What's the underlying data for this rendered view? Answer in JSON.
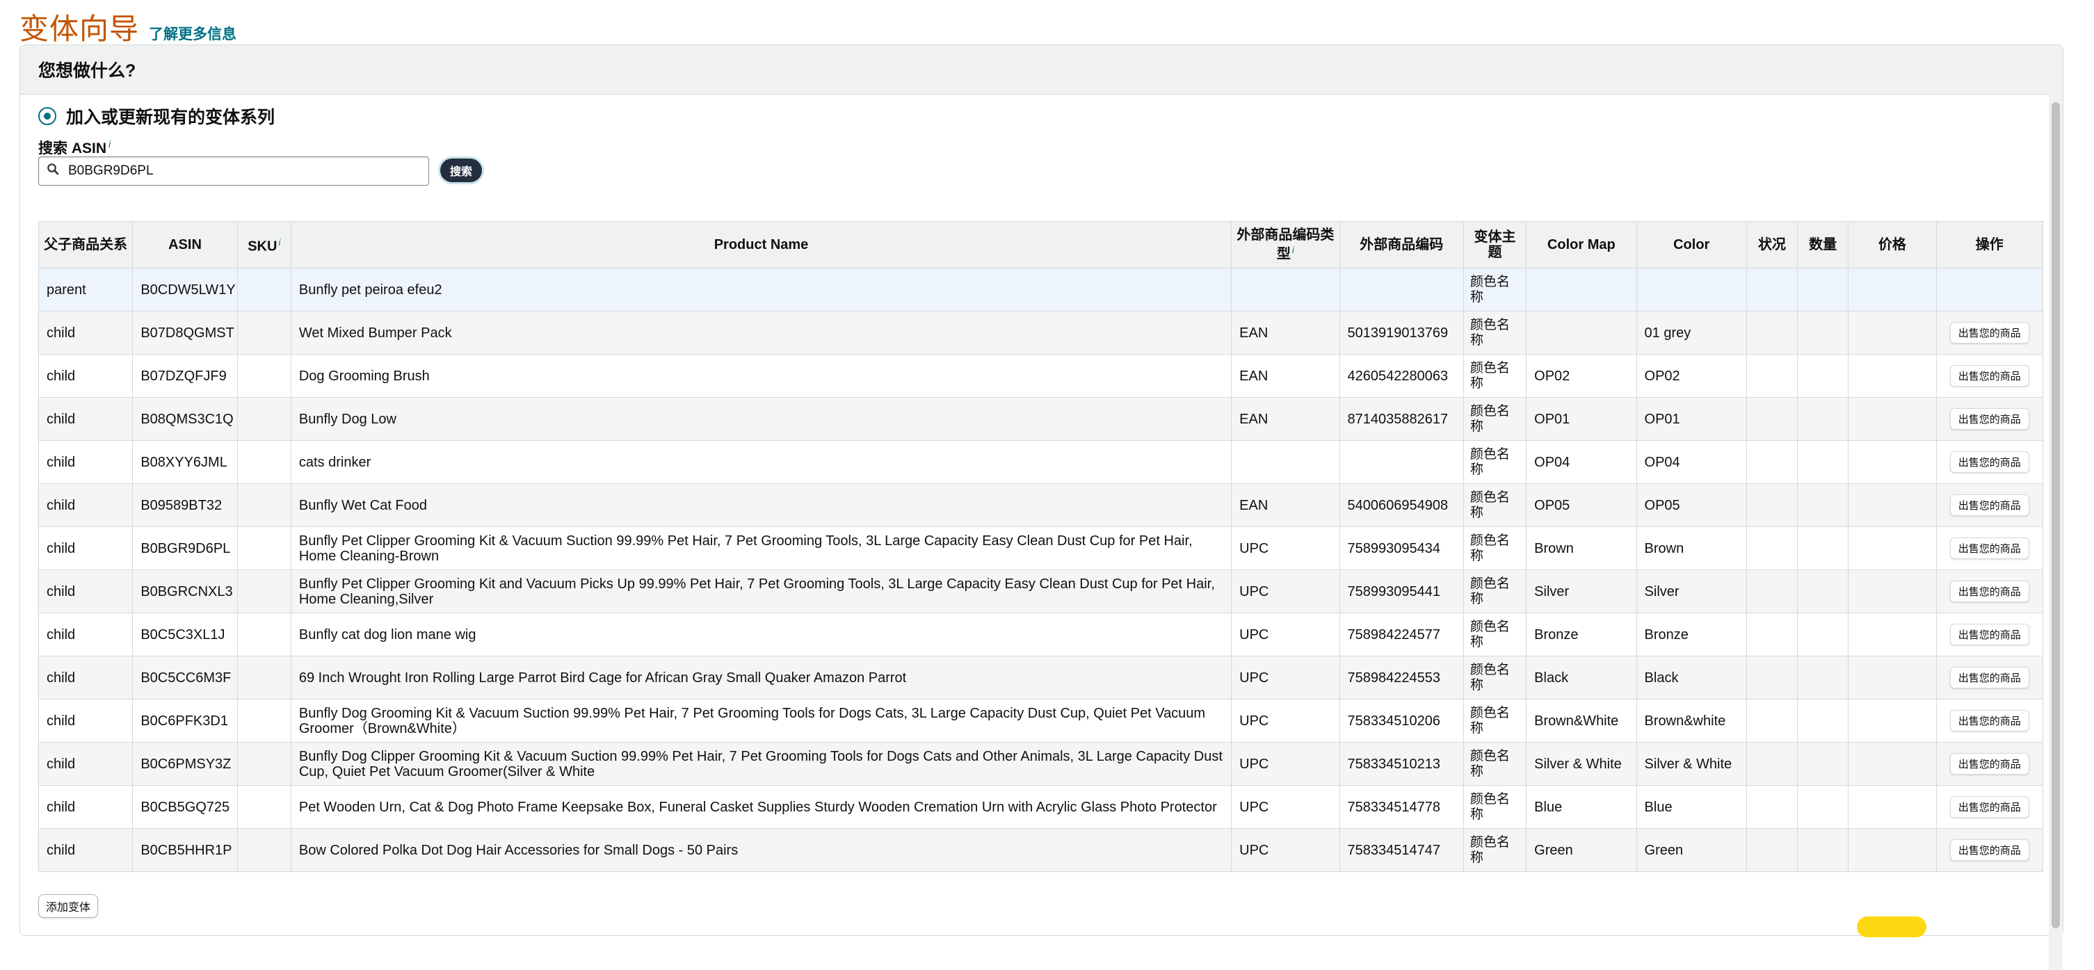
{
  "header": {
    "title": "变体向导",
    "learn_more": "了解更多信息"
  },
  "panel": {
    "heading": "您想做什么?"
  },
  "option": {
    "label": "加入或更新现有的变体系列"
  },
  "search": {
    "label": "搜索 ASIN",
    "info": "i",
    "value": "B0BGR9D6PL",
    "button": "搜索"
  },
  "table": {
    "columns": [
      "父子商品关系",
      "ASIN",
      "SKU",
      "Product Name",
      "外部商品编码类型",
      "外部商品编码",
      "变体主题",
      "Color Map",
      "Color",
      "状况",
      "数量",
      "价格",
      "操作"
    ],
    "info_mark": "i",
    "sell_label": "出售您的商品",
    "rows": [
      {
        "rel": "parent",
        "asin": "B0CDW5LW1Y",
        "sku": "",
        "name": "Bunfly pet peiroa efeu2",
        "id_type": "",
        "id": "",
        "theme": "颜色名称",
        "color_map": "",
        "color": "",
        "sell": false
      },
      {
        "rel": "child",
        "asin": "B07D8QGMST",
        "sku": "",
        "name": "Wet Mixed Bumper Pack",
        "id_type": "EAN",
        "id": "5013919013769",
        "theme": "颜色名称",
        "color_map": "",
        "color": "01 grey",
        "sell": true
      },
      {
        "rel": "child",
        "asin": "B07DZQFJF9",
        "sku": "",
        "name": "Dog Grooming Brush",
        "id_type": "EAN",
        "id": "4260542280063",
        "theme": "颜色名称",
        "color_map": "OP02",
        "color": "OP02",
        "sell": true
      },
      {
        "rel": "child",
        "asin": "B08QMS3C1Q",
        "sku": "",
        "name": "Bunfly Dog Low",
        "id_type": "EAN",
        "id": "8714035882617",
        "theme": "颜色名称",
        "color_map": "OP01",
        "color": "OP01",
        "sell": true
      },
      {
        "rel": "child",
        "asin": "B08XYY6JML",
        "sku": "",
        "name": "cats drinker",
        "id_type": "",
        "id": "",
        "theme": "颜色名称",
        "color_map": "OP04",
        "color": "OP04",
        "sell": true
      },
      {
        "rel": "child",
        "asin": "B09589BT32",
        "sku": "",
        "name": "Bunfly Wet Cat Food",
        "id_type": "EAN",
        "id": "5400606954908",
        "theme": "颜色名称",
        "color_map": "OP05",
        "color": "OP05",
        "sell": true
      },
      {
        "rel": "child",
        "asin": "B0BGR9D6PL",
        "sku": "",
        "name": "Bunfly Pet Clipper Grooming Kit & Vacuum Suction 99.99% Pet Hair, 7 Pet Grooming Tools, 3L Large Capacity Easy Clean Dust Cup for Pet Hair, Home Cleaning-Brown",
        "id_type": "UPC",
        "id": "758993095434",
        "theme": "颜色名称",
        "color_map": "Brown",
        "color": "Brown",
        "sell": true
      },
      {
        "rel": "child",
        "asin": "B0BGRCNXL3",
        "sku": "",
        "name": "Bunfly Pet Clipper Grooming Kit and Vacuum Picks Up 99.99% Pet Hair, 7 Pet Grooming Tools, 3L Large Capacity Easy Clean Dust Cup for Pet Hair, Home Cleaning,Silver",
        "id_type": "UPC",
        "id": "758993095441",
        "theme": "颜色名称",
        "color_map": "Silver",
        "color": "Silver",
        "sell": true
      },
      {
        "rel": "child",
        "asin": "B0C5C3XL1J",
        "sku": "",
        "name": "Bunfly cat dog lion mane wig",
        "id_type": "UPC",
        "id": "758984224577",
        "theme": "颜色名称",
        "color_map": "Bronze",
        "color": "Bronze",
        "sell": true
      },
      {
        "rel": "child",
        "asin": "B0C5CC6M3F",
        "sku": "",
        "name": "69 Inch Wrought Iron Rolling Large Parrot Bird Cage for African Gray Small Quaker Amazon Parrot",
        "id_type": "UPC",
        "id": "758984224553",
        "theme": "颜色名称",
        "color_map": "Black",
        "color": "Black",
        "sell": true
      },
      {
        "rel": "child",
        "asin": "B0C6PFK3D1",
        "sku": "",
        "name": "Bunfly Dog Grooming Kit & Vacuum Suction 99.99% Pet Hair, 7 Pet Grooming Tools for Dogs Cats, 3L Large Capacity Dust Cup, Quiet Pet Vacuum Groomer（Brown&White）",
        "id_type": "UPC",
        "id": "758334510206",
        "theme": "颜色名称",
        "color_map": "Brown&White",
        "color": "Brown&white",
        "sell": true
      },
      {
        "rel": "child",
        "asin": "B0C6PMSY3Z",
        "sku": "",
        "name": "Bunfly Dog Clipper Grooming Kit & Vacuum Suction 99.99% Pet Hair, 7 Pet Grooming Tools for Dogs Cats and Other Animals, 3L Large Capacity Dust Cup, Quiet Pet Vacuum Groomer(Silver & White",
        "id_type": "UPC",
        "id": "758334510213",
        "theme": "颜色名称",
        "color_map": "Silver & White",
        "color": "Silver & White",
        "sell": true
      },
      {
        "rel": "child",
        "asin": "B0CB5GQ725",
        "sku": "",
        "name": "Pet Wooden Urn, Cat & Dog Photo Frame Keepsake Box, Funeral Casket Supplies Sturdy Wooden Cremation Urn with Acrylic Glass Photo Protector",
        "id_type": "UPC",
        "id": "758334514778",
        "theme": "颜色名称",
        "color_map": "Blue",
        "color": "Blue",
        "sell": true
      },
      {
        "rel": "child",
        "asin": "B0CB5HHR1P",
        "sku": "",
        "name": "Bow Colored Polka Dot Dog Hair Accessories for Small Dogs - 50 Pairs",
        "id_type": "UPC",
        "id": "758334514747",
        "theme": "颜色名称",
        "color_map": "Green",
        "color": "Green",
        "sell": true
      }
    ]
  },
  "add_variation": "添加变体",
  "icons": {
    "search": "search-icon"
  },
  "colors": {
    "title": "#c45500",
    "link": "#007185",
    "search_button": "#232f3e",
    "header_bg": "#f0f2f2",
    "parent_row_bg": "#eef4fb"
  }
}
